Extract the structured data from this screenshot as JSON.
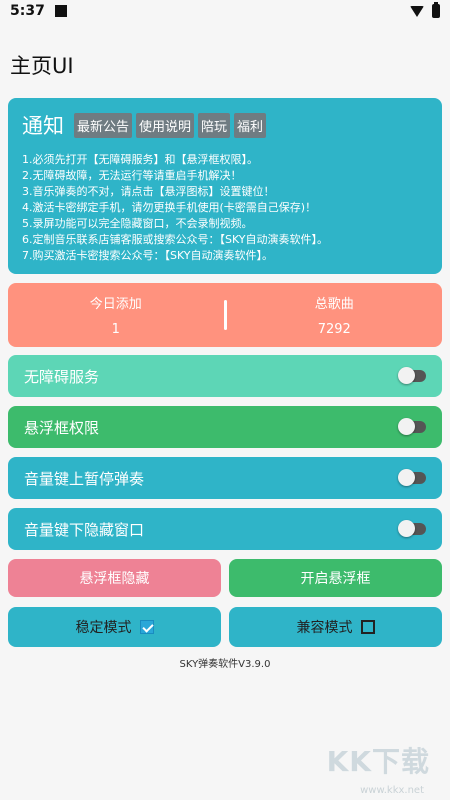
{
  "status_bar": {
    "time": "5:37"
  },
  "page": {
    "title": "主页UI"
  },
  "notice": {
    "title": "通知",
    "tabs": [
      "最新公告",
      "使用说明",
      "陪玩",
      "福利"
    ],
    "lines": [
      "1.必须先打开【无障碍服务】和【悬浮框权限】。",
      "2.无障碍故障，无法运行等请重启手机解决！",
      "3.音乐弹奏的不对，请点击【悬浮图标】设置键位！",
      "4.激活卡密绑定手机，请勿更换手机使用(卡密需自己保存)！",
      "5.录屏功能可以完全隐藏窗口，不会录制视频。",
      "6.定制音乐联系店铺客服或搜索公众号：【SKY自动演奏软件】。",
      "7.购买激活卡密搜索公众号：【SKY自动演奏软件】。"
    ]
  },
  "stats": {
    "today_label": "今日添加",
    "today_value": "1",
    "total_label": "总歌曲",
    "total_value": "7292"
  },
  "toggles": [
    {
      "label": "无障碍服务",
      "on": false,
      "color": "#5dd6b6"
    },
    {
      "label": "悬浮框权限",
      "on": false,
      "color": "#3dbb6c"
    },
    {
      "label": "音量键上暂停弹奏",
      "on": false,
      "color": "#2fb4c8"
    },
    {
      "label": "音量键下隐藏窗口",
      "on": false,
      "color": "#2fb4c8"
    }
  ],
  "buttons": {
    "hide_float": "悬浮框隐藏",
    "open_float": "开启悬浮框",
    "stable_mode": "稳定模式",
    "stable_checked": true,
    "compat_mode": "兼容模式",
    "compat_checked": false
  },
  "colors": {
    "notice_bg": "#2fb4c8",
    "stats_bg": "#ff927e",
    "hide_btn": "#ee8295",
    "open_btn": "#3dbb6c",
    "mode_btn": "#2fb4c8"
  },
  "version": "SKY弹奏软件V3.9.0",
  "watermark": {
    "text": "KK下载",
    "url": "www.kkx.net"
  }
}
